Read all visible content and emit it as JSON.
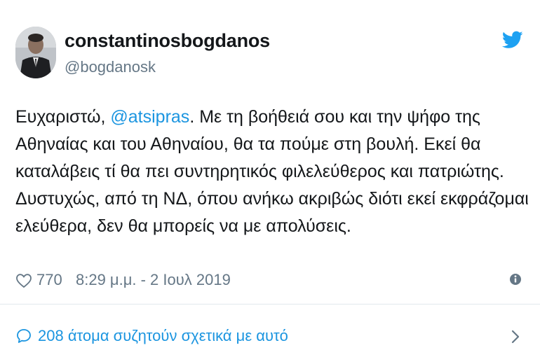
{
  "author": {
    "display_name": "constantinosbogdanos",
    "handle": "@bogdanosk"
  },
  "tweet": {
    "line1_prefix": "Ευχαριστώ, ",
    "mention": "@atsipras",
    "line1_suffix": ". Με τη βοήθειά σου και την ψήφο της",
    "line2": "Αθηναίας και του Αθηναίου, θα τα πούμε στη βουλή. Εκεί θα",
    "line3": "καταλάβεις τί θα πει συντηρητικός φιλελεύθερος και πατριώτης.",
    "line4": "Δυστυχώς, από τη ΝΔ, όπου ανήκω ακριβώς διότι εκεί εκφράζομαι",
    "line5": "ελεύθερα, δεν θα μπορείς να με απολύσεις."
  },
  "meta": {
    "likes": "770",
    "timestamp": "8:29 μ.μ. - 2 Ιουλ 2019"
  },
  "conversation": {
    "label": "208 άτομα συζητούν σχετικά με αυτό"
  },
  "colors": {
    "link": "#1b95e0",
    "secondary": "#657786",
    "divider": "#e1e8ed"
  },
  "icons": [
    "twitter-bird-icon",
    "heart-icon",
    "info-icon",
    "speech-bubble-icon",
    "chevron-right-icon"
  ]
}
